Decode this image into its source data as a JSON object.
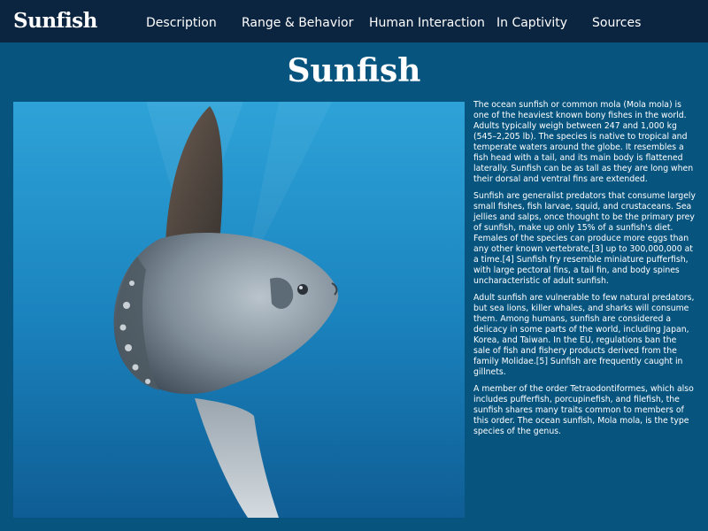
{
  "nav": {
    "brand": "Sunfish",
    "links": [
      {
        "label": "Description"
      },
      {
        "label": "Range & Behavior"
      },
      {
        "label": "Human Interaction"
      },
      {
        "label": "In Captivity"
      },
      {
        "label": "Sources"
      }
    ]
  },
  "page": {
    "title": "Sunfish"
  },
  "article": {
    "paragraphs": [
      "The ocean sunfish or common mola (Mola mola) is one of the heaviest known bony fishes in the world. Adults typically weigh between 247 and 1,000 kg (545–2,205 lb). The species is native to tropical and temperate waters around the globe. It resembles a fish head with a tail, and its main body is flattened laterally. Sunfish can be as tall as they are long when their dorsal and ventral fins are extended.",
      "Sunfish are generalist predators that consume largely small fishes, fish larvae, squid, and crustaceans. Sea jellies and salps, once thought to be the primary prey of sunfish, make up only 15% of a sunfish's diet. Females of the species can produce more eggs than any other known vertebrate,[3] up to 300,000,000 at a time.[4] Sunfish fry resemble miniature pufferfish, with large pectoral fins, a tail fin, and body spines uncharacteristic of adult sunfish.",
      "Adult sunfish are vulnerable to few natural predators, but sea lions, killer whales, and sharks will consume them. Among humans, sunfish are considered a delicacy in some parts of the world, including Japan, Korea, and Taiwan. In the EU, regulations ban the sale of fish and fishery products derived from the family Molidae.[5] Sunfish are frequently caught in gillnets.",
      "A member of the order Tetraodontiformes, which also includes pufferfish, porcupinefish, and filefish, the sunfish shares many traits common to members of this order. The ocean sunfish, Mola mola, is the type species of the genus."
    ]
  },
  "colors": {
    "nav_background": "#0b2440",
    "page_background": "#07557f",
    "text": "#ffffff",
    "water": "#1a7fba"
  },
  "icons": {
    "photo": "sunfish-photo"
  }
}
